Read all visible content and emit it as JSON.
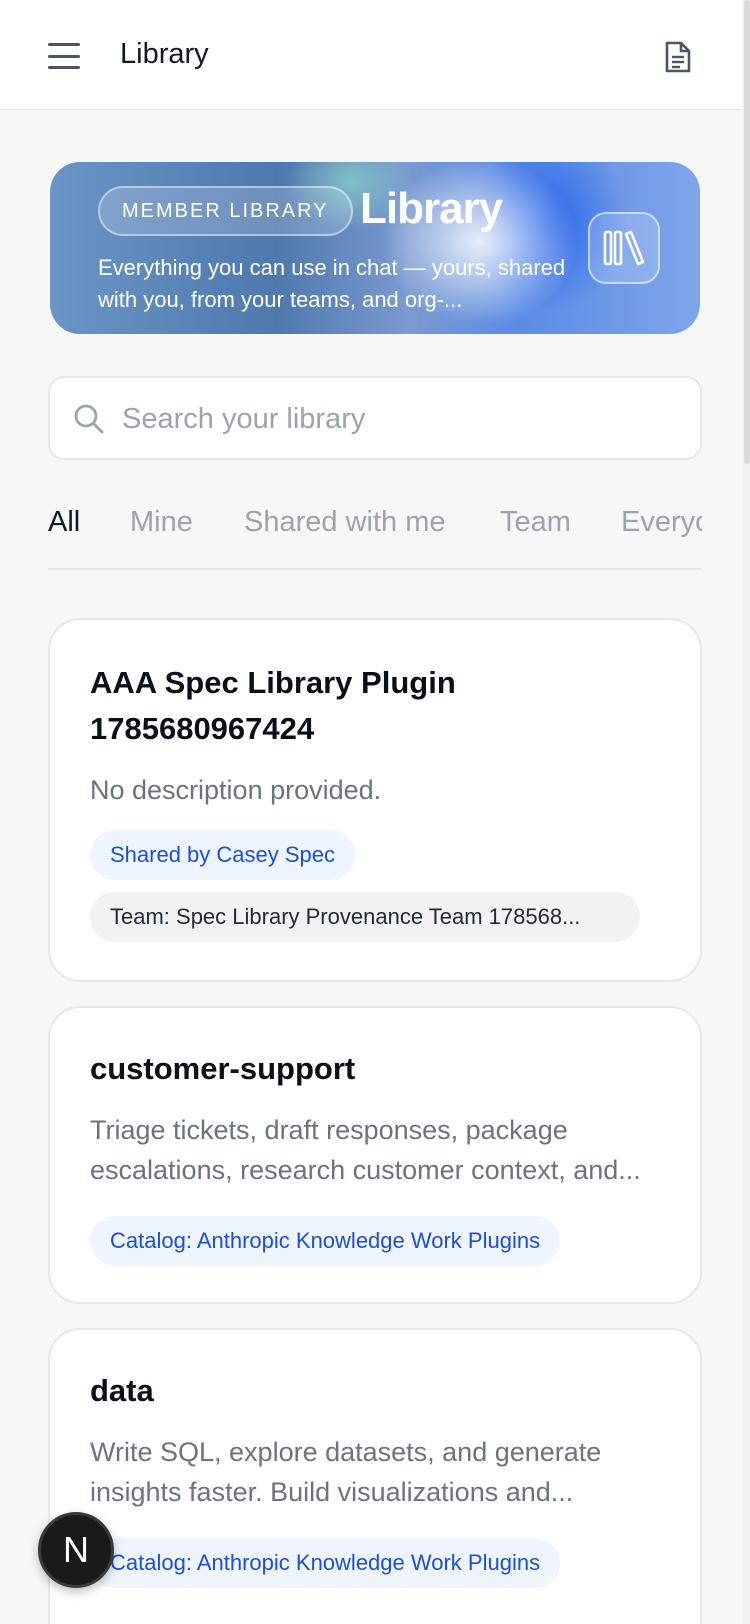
{
  "topbar": {
    "title": "Library",
    "menu_icon": "hamburger-menu-icon",
    "doc_icon": "document-icon"
  },
  "hero": {
    "badge": "MEMBER LIBRARY",
    "title": "Library",
    "description": "Everything you can use in chat — yours, shared with you, from your teams, and org-...",
    "icon": "books-icon"
  },
  "search": {
    "placeholder": "Search your library",
    "value": ""
  },
  "tabs": [
    {
      "label": "All",
      "active": true
    },
    {
      "label": "Mine",
      "active": false
    },
    {
      "label": "Shared with me",
      "active": false
    },
    {
      "label": "Team",
      "active": false
    },
    {
      "label": "Everyo",
      "active": false
    }
  ],
  "cards": [
    {
      "title_line1": "AAA Spec Library Plugin",
      "title_line2": "1785680967424",
      "description": "No description provided.",
      "chips": [
        "Shared by Casey Spec",
        "Team: Spec Library Provenance Team 178568..."
      ]
    },
    {
      "title": "customer-support",
      "description": "Triage tickets, draft responses, package escalations, research customer context, and...",
      "chips": [
        "Catalog: Anthropic Knowledge Work Plugins"
      ]
    },
    {
      "title": "data",
      "description": "Write SQL, explore datasets, and generate insights faster. Build visualizations and...",
      "chips": [
        "Catalog: Anthropic Knowledge Work Plugins"
      ]
    }
  ],
  "fab": {
    "label": "N"
  },
  "colors": {
    "accent_blue": "#1d4ed8",
    "chip_blue_bg": "#eff5ff",
    "chip_gray_bg": "#f1f2f4",
    "page_bg": "#f7f7f7"
  }
}
